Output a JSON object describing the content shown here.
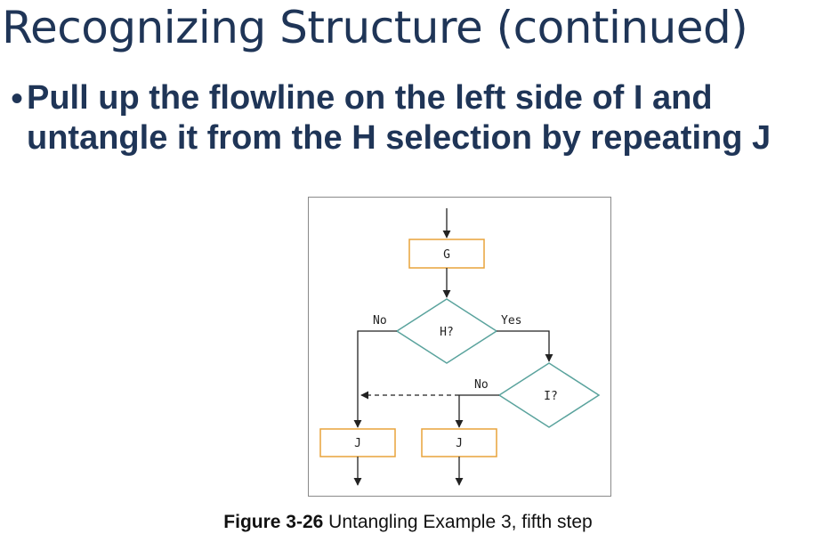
{
  "slide": {
    "title": "Recognizing Structure (continued)",
    "bullet_marker": "•",
    "bullet_text": "Pull up the flowline on the left side of I and untangle it from the H selection by repeating J"
  },
  "diagram": {
    "nodes": {
      "g": "G",
      "h": "H?",
      "i": "I?",
      "j_left": "J",
      "j_right": "J"
    },
    "labels": {
      "h_no": "No",
      "h_yes": "Yes",
      "i_no": "No"
    },
    "colors": {
      "process_border": "#e8a33a",
      "decision_border": "#5aa39d",
      "line": "#222222",
      "label": "#222222"
    }
  },
  "caption": {
    "number": "Figure 3-26",
    "text": " Untangling Example 3, fifth step"
  }
}
